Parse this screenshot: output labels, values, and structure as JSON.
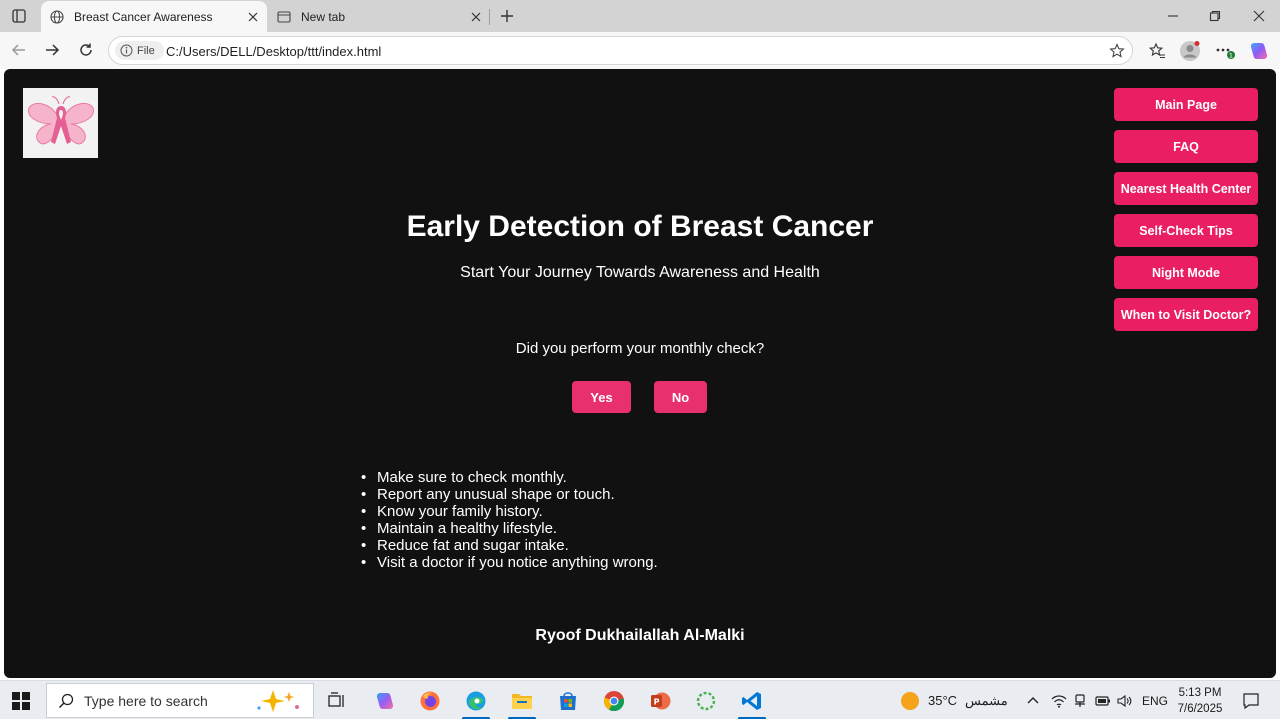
{
  "browser": {
    "tabs": [
      {
        "title": "Breast Cancer Awareness",
        "active": true
      },
      {
        "title": "New tab",
        "active": false
      }
    ],
    "site_info_label": "File",
    "url": "C:/Users/DELL/Desktop/ttt/index.html"
  },
  "page": {
    "title": "Early Detection of Breast Cancer",
    "subtitle": "Start Your Journey Towards Awareness and Health",
    "question": "Did you perform your monthly check?",
    "yes_label": "Yes",
    "no_label": "No",
    "tips": [
      "Make sure to check monthly.",
      "Report any unusual shape or touch.",
      "Know your family history.",
      "Maintain a healthy lifestyle.",
      "Reduce fat and sugar intake.",
      "Visit a doctor if you notice anything wrong."
    ],
    "author": "Ryoof Dukhailallah Al-Malki",
    "nav": [
      "Main Page",
      "FAQ",
      "Nearest Health Center",
      "Self-Check Tips",
      "Night Mode",
      "When to Visit Doctor?"
    ],
    "colors": {
      "background": "#111112",
      "accent": "#e91e63",
      "logo_pink": "#f48fb1"
    }
  },
  "taskbar": {
    "search_placeholder": "Type here to search",
    "weather_temp": "35°C",
    "weather_text": "مشمس",
    "language": "ENG",
    "time": "5:13 PM",
    "date": "7/6/2025"
  }
}
